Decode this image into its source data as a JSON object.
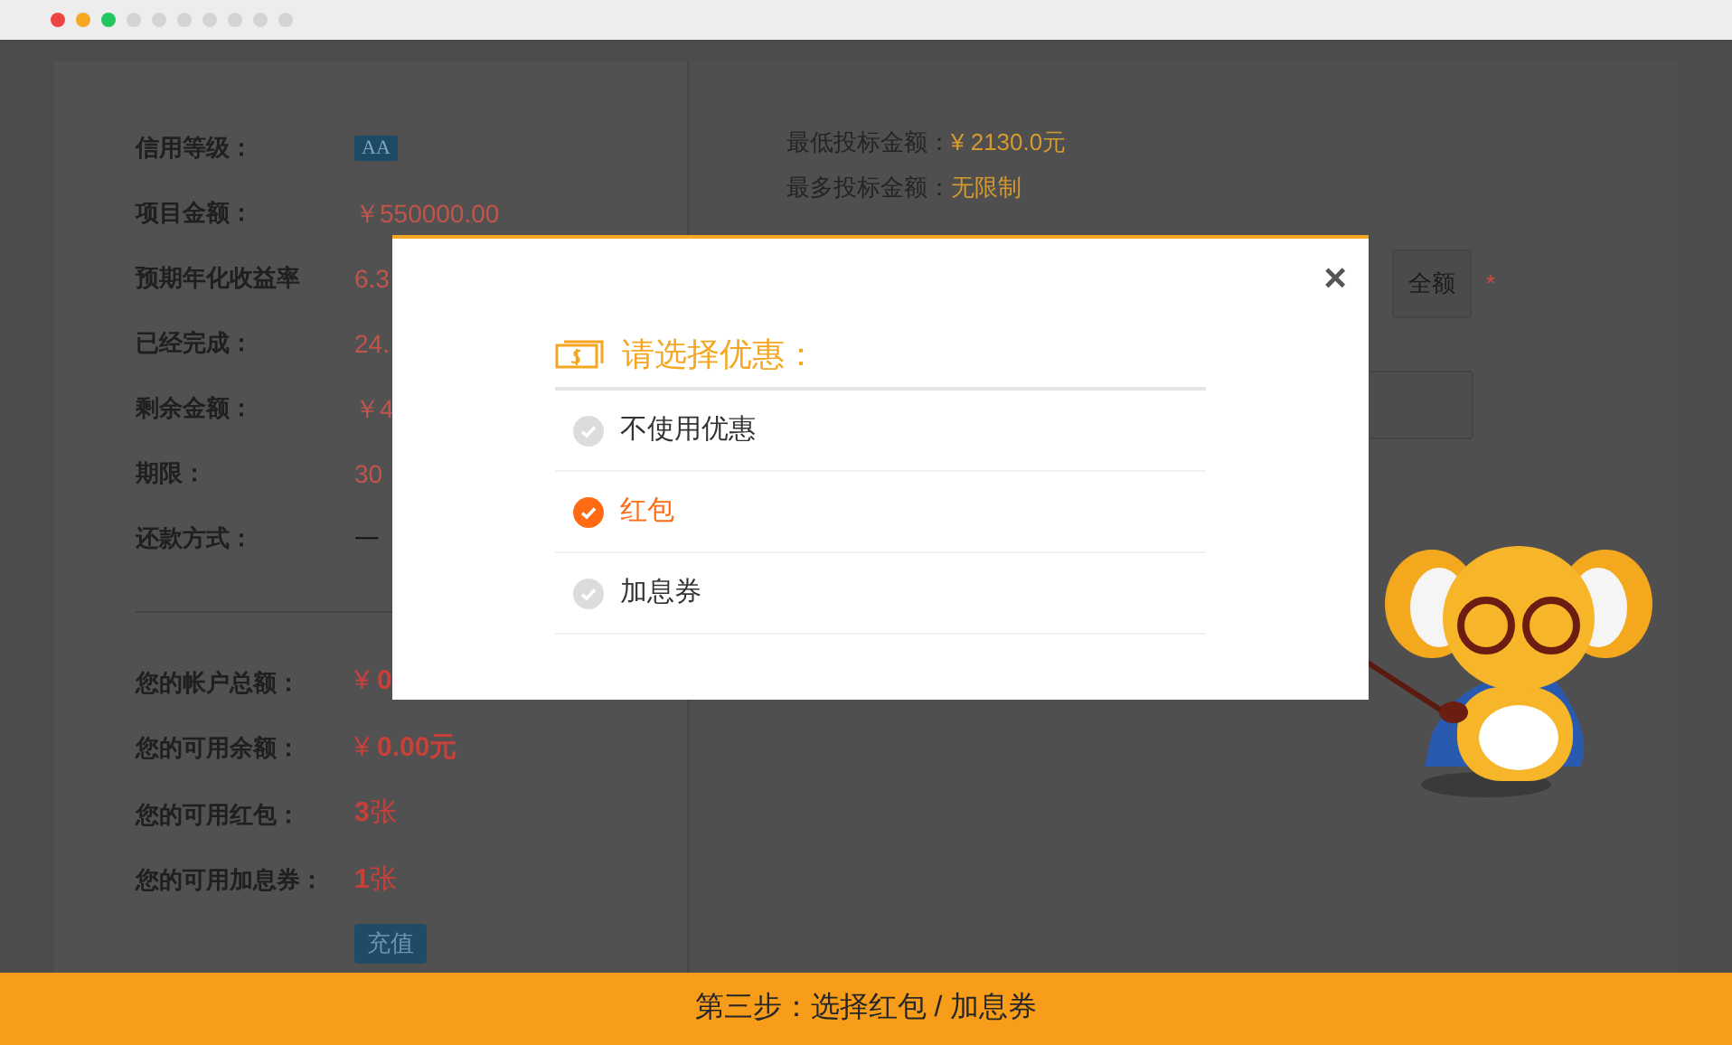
{
  "browser": {
    "dots": [
      {
        "color": "#ef4444"
      },
      {
        "color": "#f5a623"
      },
      {
        "color": "#22c55e"
      },
      {
        "color": "#d4d4d4"
      },
      {
        "color": "#d4d4d4"
      },
      {
        "color": "#d4d4d4"
      },
      {
        "color": "#d4d4d4"
      },
      {
        "color": "#d4d4d4"
      },
      {
        "color": "#d4d4d4"
      },
      {
        "color": "#d4d4d4"
      }
    ]
  },
  "project_details": [
    {
      "label": "信用等级：",
      "value": "AA",
      "kind": "badge"
    },
    {
      "label": "项目金额：",
      "value": "￥550000.00",
      "kind": "amount"
    },
    {
      "label": "预期年化收益率",
      "value": "6.3",
      "kind": "amount"
    },
    {
      "label": "已经完成：",
      "value": "24.",
      "kind": "amount"
    },
    {
      "label": "剩余金额：",
      "value": "￥4",
      "kind": "amount"
    },
    {
      "label": "期限：",
      "value": "30",
      "kind": "amount"
    },
    {
      "label": "还款方式：",
      "value": "一",
      "kind": "plain"
    }
  ],
  "account": [
    {
      "label": "您的帐户总额：",
      "value": "¥ **0**"
    },
    {
      "label": "您的可用余额：",
      "value": "¥ **0.00元**"
    },
    {
      "label": "您的可用红包：",
      "value": "**3**张"
    },
    {
      "label": "您的可用加息券：",
      "value": "**1**张"
    }
  ],
  "recharge_button": "充值",
  "bid_limits": [
    {
      "label": "最低投标金额：",
      "value": "¥ 2130.0元"
    },
    {
      "label": "最多投标金额：",
      "value": "无限制"
    }
  ],
  "full_amount_button": "全额",
  "required_mark": "*",
  "modal": {
    "close": "×",
    "title": "请选择优惠：",
    "options": [
      {
        "label": "不使用优惠",
        "selected": false
      },
      {
        "label": "红包",
        "selected": true
      },
      {
        "label": "加息券",
        "selected": false
      }
    ]
  },
  "footer": {
    "caption": "第三步：选择红包 / 加息券"
  }
}
